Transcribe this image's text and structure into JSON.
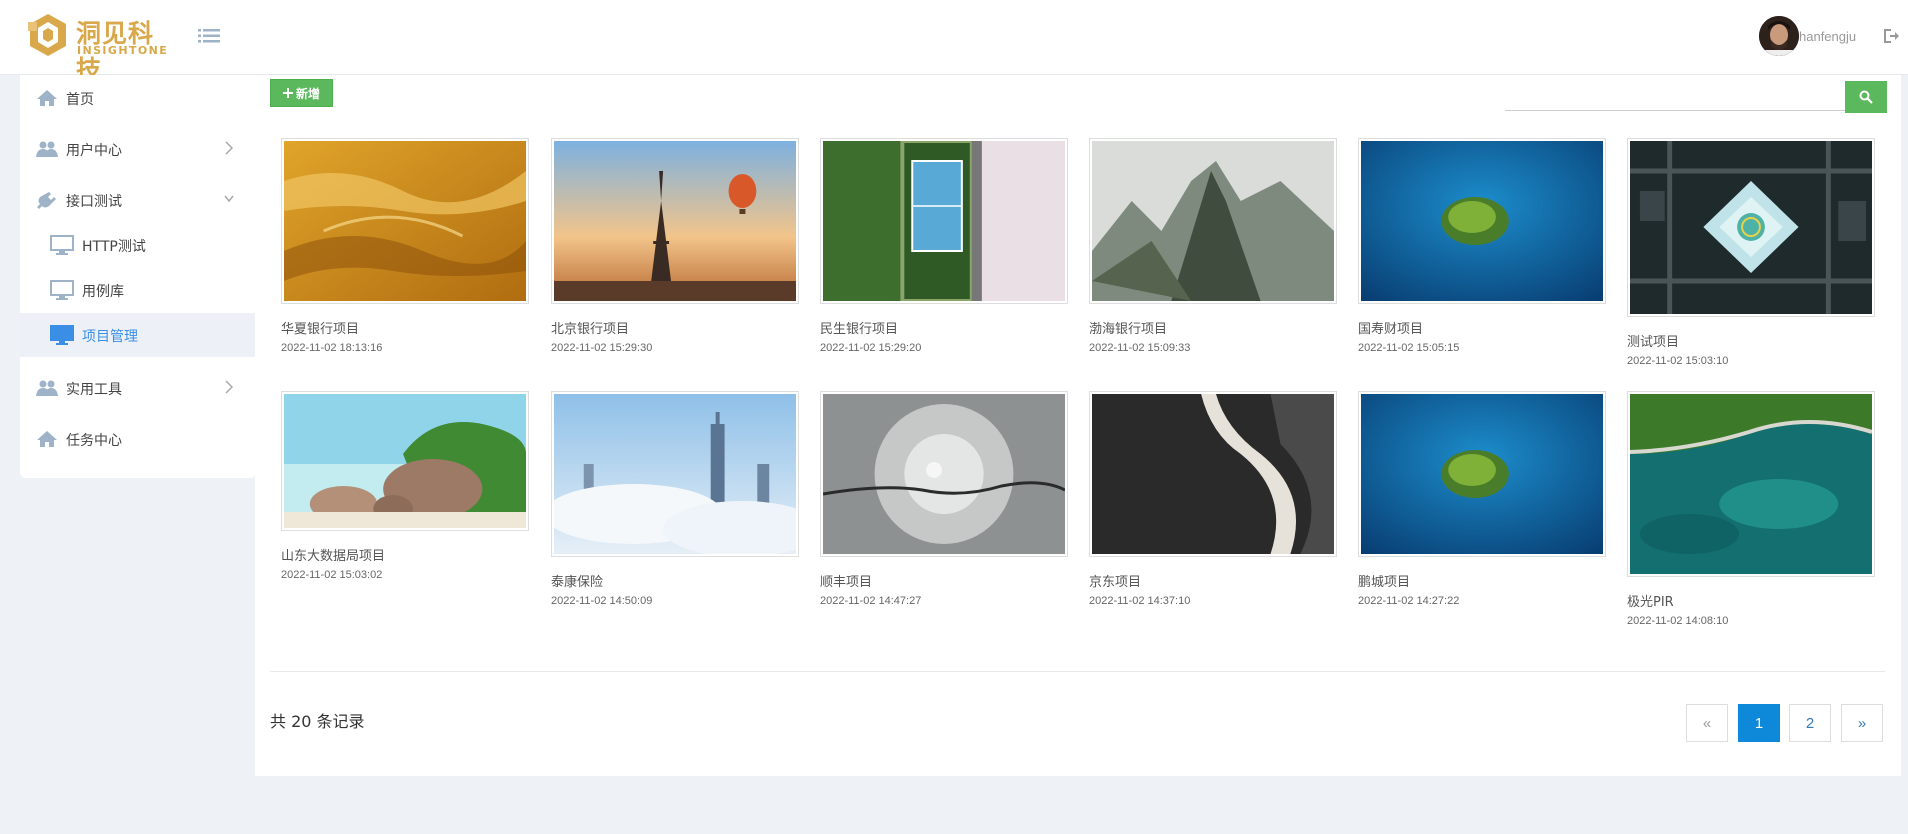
{
  "brand": {
    "name_cn": "洞见科技",
    "name_en": "INSIGHTONE",
    "color": "#d9a84a"
  },
  "user": {
    "name": "hanfengju"
  },
  "icons": {
    "menu_toggle": "list-icon",
    "logout": "sign-out-icon",
    "search": "search-icon",
    "add": "plus-icon"
  },
  "sidebar": {
    "items": [
      {
        "label": "首页",
        "icon": "home-icon"
      },
      {
        "label": "用户中心",
        "icon": "users-icon",
        "chevron": "right"
      },
      {
        "label": "接口测试",
        "icon": "plug-icon",
        "chevron": "down"
      },
      {
        "label": "HTTP测试",
        "icon": "desktop-icon"
      },
      {
        "label": "用例库",
        "icon": "desktop-icon"
      },
      {
        "label": "项目管理",
        "icon": "desktop-icon",
        "active": true
      },
      {
        "label": "实用工具",
        "icon": "users-icon",
        "chevron": "right"
      },
      {
        "label": "任务中心",
        "icon": "home-icon"
      }
    ]
  },
  "toolbar": {
    "add_label": "新增",
    "search_placeholder": ""
  },
  "projects": [
    {
      "name": "华夏银行项目",
      "date": "2022-11-02 18:13:16",
      "image": "desert-dunes"
    },
    {
      "name": "北京银行项目",
      "date": "2022-11-02 15:29:30",
      "image": "eiffel-tower-balloon"
    },
    {
      "name": "民生银行项目",
      "date": "2022-11-02 15:29:20",
      "image": "tennis-court-aerial"
    },
    {
      "name": "渤海银行项目",
      "date": "2022-11-02 15:09:33",
      "image": "misty-mountains"
    },
    {
      "name": "国寿财项目",
      "date": "2022-11-02 15:05:15",
      "image": "island-blue-sea"
    },
    {
      "name": "测试项目",
      "date": "2022-11-02 15:03:10",
      "image": "city-aerial-night"
    },
    {
      "name": "山东大数据局项目",
      "date": "2022-11-02 15:03:02",
      "image": "tropical-beach-rocks"
    },
    {
      "name": "泰康保险",
      "date": "2022-11-02 14:50:09",
      "image": "skyscrapers-in-clouds"
    },
    {
      "name": "顺丰项目",
      "date": "2022-11-02 14:47:27",
      "image": "snowy-forest-aerial"
    },
    {
      "name": "京东项目",
      "date": "2022-11-02 14:37:10",
      "image": "black-sand-shore"
    },
    {
      "name": "鹏城项目",
      "date": "2022-11-02 14:27:22",
      "image": "island-blue-sea"
    },
    {
      "name": "极光PIR",
      "date": "2022-11-02 14:08:10",
      "image": "coastal-road-lagoon"
    }
  ],
  "pagination": {
    "total_text": "共 20 条记录",
    "prev": "«",
    "pages": [
      "1",
      "2"
    ],
    "current": "1",
    "next": "»"
  },
  "colors": {
    "accent_green": "#5cb85c",
    "pager_active": "#0e88d8",
    "sidebar_active_text": "#3a8ee6",
    "page_bg": "#eef1f6"
  }
}
